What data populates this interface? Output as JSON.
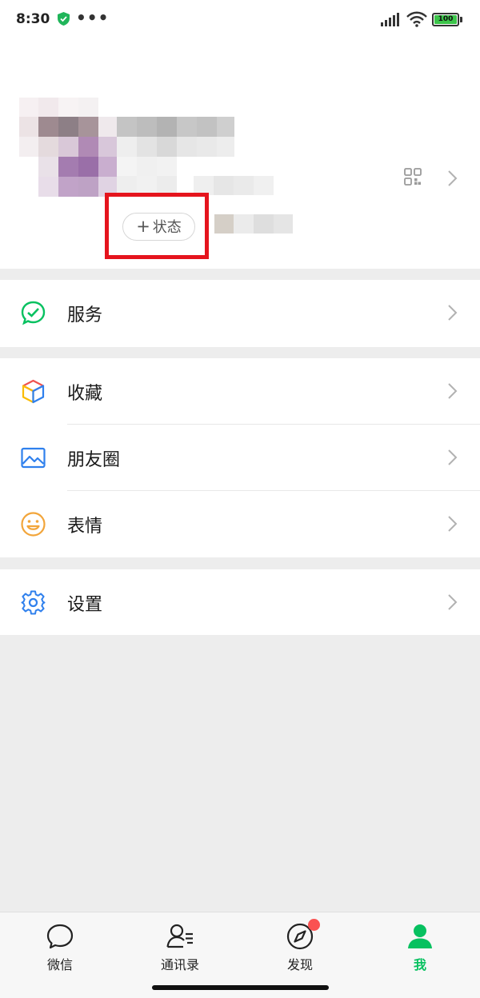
{
  "status_bar": {
    "time": "8:30",
    "dots": "•••",
    "battery": "100"
  },
  "profile": {
    "status_button_label": "状态",
    "status_button_plus": "+"
  },
  "menu": {
    "services": "服务",
    "favorites": "收藏",
    "moments": "朋友圈",
    "stickers": "表情",
    "settings": "设置"
  },
  "tabs": [
    {
      "label": "微信",
      "icon": "chat-bubble-icon",
      "active": false
    },
    {
      "label": "通讯录",
      "icon": "contacts-icon",
      "active": false
    },
    {
      "label": "发现",
      "icon": "compass-icon",
      "active": false
    },
    {
      "label": "我",
      "icon": "person-icon",
      "active": true
    }
  ],
  "colors": {
    "accent": "#07c160",
    "highlight": "#e5141d",
    "badge": "#fa5151"
  }
}
